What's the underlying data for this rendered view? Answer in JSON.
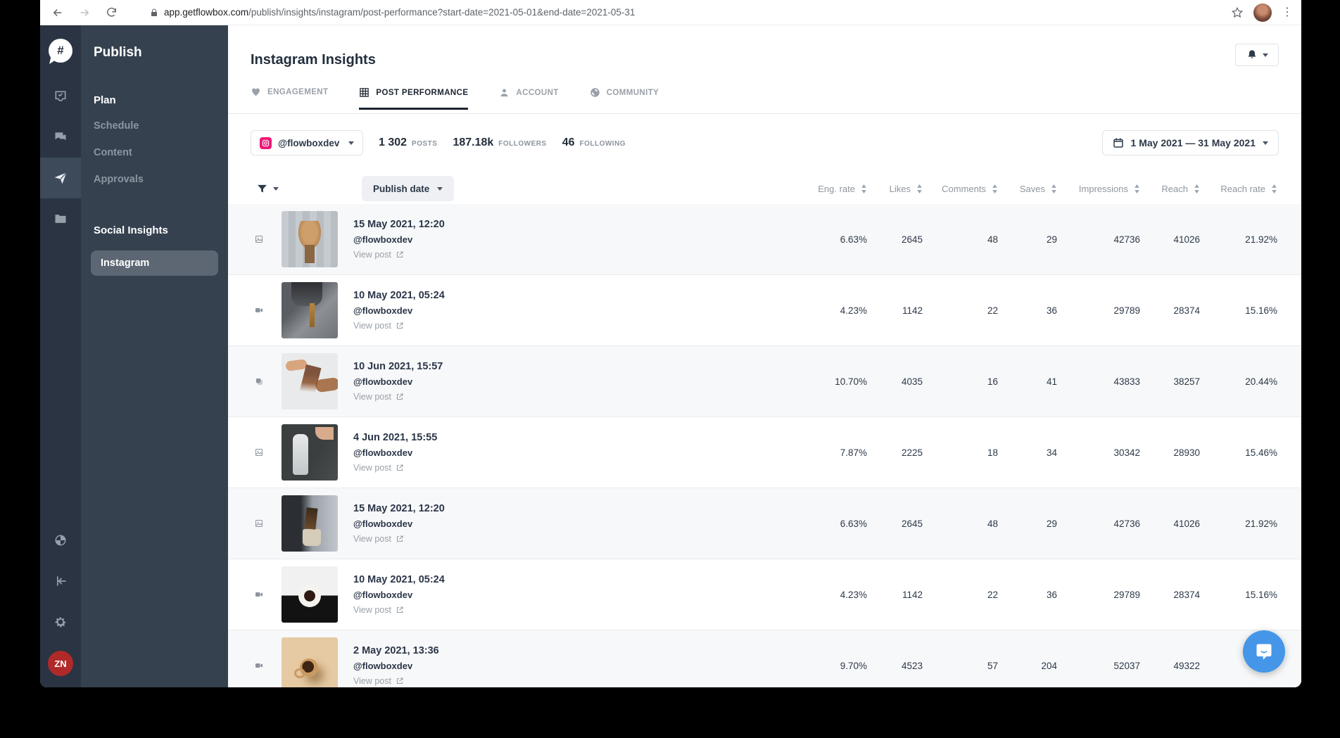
{
  "browser": {
    "url_domain": "app.getflowbox.com",
    "url_path": "/publish/insights/instagram/post-performance?start-date=2021-05-01&end-date=2021-05-31"
  },
  "rail": {
    "avatar_initials": "ZN"
  },
  "sidebar": {
    "title": "Publish",
    "plan_section": "Plan",
    "plan_items": [
      "Schedule",
      "Content",
      "Approvals"
    ],
    "insights_section": "Social Insights",
    "active_item": "Instagram"
  },
  "header": {
    "title": "Instagram Insights"
  },
  "tabs": [
    {
      "label": "ENGAGEMENT",
      "active": false
    },
    {
      "label": "POST PERFORMANCE",
      "active": true
    },
    {
      "label": "ACCOUNT",
      "active": false
    },
    {
      "label": "COMMUNITY",
      "active": false
    }
  ],
  "filters": {
    "account": "@flowboxdev",
    "stats": [
      {
        "value": "1 302",
        "label": "POSTS"
      },
      {
        "value": "187.18k",
        "label": "FOLLOWERS"
      },
      {
        "value": "46",
        "label": "FOLLOWING"
      }
    ],
    "date_range": "1 May 2021 — 31 May 2021"
  },
  "table": {
    "sort_label": "Publish date",
    "view_post_label": "View post",
    "columns": [
      "Eng. rate",
      "Likes",
      "Comments",
      "Saves",
      "Impressions",
      "Reach",
      "Reach rate"
    ],
    "rows": [
      {
        "type": "image",
        "date": "15 May 2021, 12:20",
        "handle": "@flowboxdev",
        "eng_rate": "6.63%",
        "likes": "2645",
        "comments": "48",
        "saves": "29",
        "impressions": "42736",
        "reach": "41026",
        "reach_rate": "21.92%"
      },
      {
        "type": "video",
        "date": "10 May 2021, 05:24",
        "handle": "@flowboxdev",
        "eng_rate": "4.23%",
        "likes": "1142",
        "comments": "22",
        "saves": "36",
        "impressions": "29789",
        "reach": "28374",
        "reach_rate": "15.16%"
      },
      {
        "type": "carousel",
        "date": "10 Jun 2021, 15:57",
        "handle": "@flowboxdev",
        "eng_rate": "10.70%",
        "likes": "4035",
        "comments": "16",
        "saves": "41",
        "impressions": "43833",
        "reach": "38257",
        "reach_rate": "20.44%"
      },
      {
        "type": "image",
        "date": "4 Jun 2021, 15:55",
        "handle": "@flowboxdev",
        "eng_rate": "7.87%",
        "likes": "2225",
        "comments": "18",
        "saves": "34",
        "impressions": "30342",
        "reach": "28930",
        "reach_rate": "15.46%"
      },
      {
        "type": "image",
        "date": "15 May 2021, 12:20",
        "handle": "@flowboxdev",
        "eng_rate": "6.63%",
        "likes": "2645",
        "comments": "48",
        "saves": "29",
        "impressions": "42736",
        "reach": "41026",
        "reach_rate": "21.92%"
      },
      {
        "type": "video",
        "date": "10 May 2021, 05:24",
        "handle": "@flowboxdev",
        "eng_rate": "4.23%",
        "likes": "1142",
        "comments": "22",
        "saves": "36",
        "impressions": "29789",
        "reach": "28374",
        "reach_rate": "15.16%"
      },
      {
        "type": "video",
        "date": "2 May 2021, 13:36",
        "handle": "@flowboxdev",
        "eng_rate": "9.70%",
        "likes": "4523",
        "comments": "57",
        "saves": "204",
        "impressions": "52037",
        "reach": "49322",
        "reach_rate": ""
      }
    ]
  },
  "colors": {
    "rail_bg": "#2b3443",
    "sidebar_bg": "#35414f",
    "active_pill": "#5d6774",
    "accent_pink": "#ec1878",
    "avatar_red": "#b02a2a",
    "intercom_blue": "#4596e8"
  }
}
